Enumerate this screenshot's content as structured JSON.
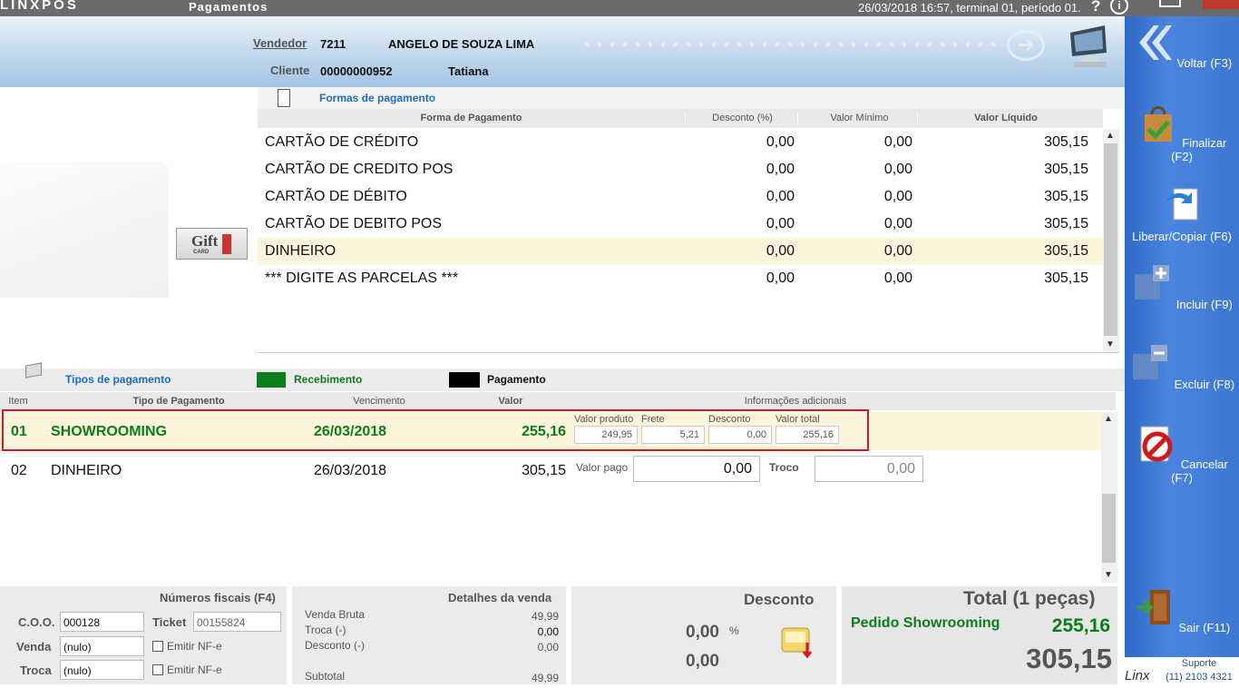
{
  "app": {
    "brand": "LINXPOS",
    "screen_title": "Pagamentos",
    "session_info": "26/03/2018 16:57, terminal 01, período 01."
  },
  "header": {
    "vendedor_label": "Vendedor",
    "vendedor_code": "7211",
    "vendedor_name": "ANGELO DE SOUZA LIMA",
    "cliente_label": "Cliente",
    "cliente_code": "00000000952",
    "cliente_name": "Tatiana"
  },
  "giftcard": {
    "label": "Gift",
    "sub": "CARD"
  },
  "formas": {
    "title": "Formas de pagamento",
    "columns": [
      "Forma de Pagamento",
      "Desconto (%)",
      "Valor Mínimo",
      "Valor Líquido"
    ],
    "rows": [
      {
        "name": "CARTÃO DE CRÉDITO",
        "desconto": "0,00",
        "minimo": "0,00",
        "liquido": "305,15"
      },
      {
        "name": "CARTÃO DE CREDITO POS",
        "desconto": "0,00",
        "minimo": "0,00",
        "liquido": "305,15"
      },
      {
        "name": "CARTÃO DE DÉBITO",
        "desconto": "0,00",
        "minimo": "0,00",
        "liquido": "305,15"
      },
      {
        "name": "CARTÃO DE DEBITO POS",
        "desconto": "0,00",
        "minimo": "0,00",
        "liquido": "305,15"
      },
      {
        "name": "DINHEIRO",
        "desconto": "0,00",
        "minimo": "0,00",
        "liquido": "305,15"
      },
      {
        "name": "*** DIGITE AS PARCELAS ***",
        "desconto": "0,00",
        "minimo": "0,00",
        "liquido": "305,15"
      }
    ]
  },
  "tipos": {
    "title": "Tipos de pagamento",
    "legend_recebimento": "Recebimento",
    "legend_pagamento": "Pagamento",
    "columns": [
      "Item",
      "Tipo de Pagamento",
      "Vencimento",
      "Valor",
      "Informações adicionais"
    ],
    "row1": {
      "item": "01",
      "tipo": "SHOWROOMING",
      "vencimento": "26/03/2018",
      "valor": "255,16",
      "valor_produto_label": "Valor produto",
      "valor_produto": "249,95",
      "frete_label": "Frete",
      "frete": "5,21",
      "desconto_label": "Desconto",
      "desconto": "0,00",
      "valor_total_label": "Valor total",
      "valor_total": "255,16"
    },
    "row2": {
      "item": "02",
      "tipo": "DINHEIRO",
      "vencimento": "26/03/2018",
      "valor": "305,15",
      "valor_pago_label": "Valor pago",
      "valor_pago": "0,00",
      "troco_label": "Troco",
      "troco": "0,00"
    }
  },
  "fiscais": {
    "title": "Números fiscais (F4)",
    "coo_label": "C.O.O.",
    "coo": "000128",
    "ticket_label": "Ticket",
    "ticket": "00155824",
    "venda_label": "Venda",
    "venda": "(nulo)",
    "troca_label": "Troca",
    "troca": "(nulo)",
    "emitir_label": "Emitir NF-e"
  },
  "detalhes": {
    "title": "Detalhes da venda",
    "venda_bruta_label": "Venda Bruta",
    "venda_bruta": "49,99",
    "troca_label": "Troca (-)",
    "troca": "0,00",
    "desconto_label": "Desconto (-)",
    "desconto": "0,00",
    "subtotal_label": "Subtotal",
    "subtotal": "49,99"
  },
  "desconto_panel": {
    "title": "Desconto",
    "percent": "0,00",
    "percent_symbol": "%",
    "valor": "0,00"
  },
  "total_panel": {
    "title": "Total (1 peças)",
    "pedido_label": "Pedido Showrooming",
    "pedido_valor": "255,16",
    "total": "305,15"
  },
  "sidebar": {
    "voltar": "Voltar (F3)",
    "finalizar": "Finalizar (F2)",
    "liberar": "Liberar/Copiar (F6)",
    "incluir": "Incluir (F9)",
    "excluir": "Excluir (F8)",
    "cancelar": "Cancelar (F7)",
    "sair": "Sair (F11)",
    "suporte_label": "Suporte",
    "suporte_phone": "(11) 2103 4321",
    "linx_logo": "Linx"
  },
  "colors": {
    "accent_blue": "#1d6dc0",
    "recebimento": "#0b7d1a",
    "pagamento": "#000000",
    "selected_row": "#fdf4dc",
    "highlight_border": "#d0191e"
  }
}
